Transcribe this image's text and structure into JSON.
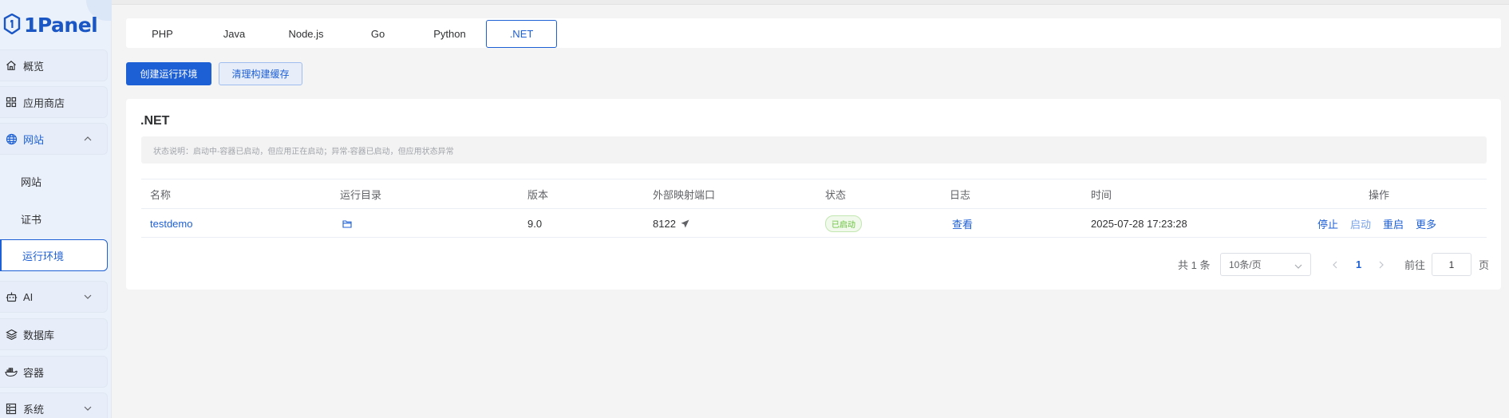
{
  "brand": {
    "logo_text": "1Panel",
    "accent": "#1d5fd4"
  },
  "sidebar": {
    "items": [
      {
        "label": "概览",
        "icon": "home-icon"
      },
      {
        "label": "应用商店",
        "icon": "grid-icon"
      },
      {
        "label": "网站",
        "icon": "globe-icon",
        "expanded": true
      },
      {
        "label": "AI",
        "icon": "robot-icon"
      },
      {
        "label": "数据库",
        "icon": "layers-icon"
      },
      {
        "label": "容器",
        "icon": "docker-icon"
      },
      {
        "label": "系统",
        "icon": "server-icon"
      }
    ],
    "subitems": [
      {
        "label": "网站"
      },
      {
        "label": "证书"
      },
      {
        "label": "运行环境",
        "active": true
      }
    ]
  },
  "tabs": [
    {
      "label": "PHP"
    },
    {
      "label": "Java"
    },
    {
      "label": "Node.js"
    },
    {
      "label": "Go"
    },
    {
      "label": "Python"
    },
    {
      "label": ".NET",
      "active": true
    }
  ],
  "toolbar": {
    "create_label": "创建运行环境",
    "clear_cache_label": "清理构建缓存"
  },
  "card": {
    "title": ".NET",
    "notice": "状态说明：启动中-容器已启动，但应用正在启动；异常-容器已启动，但应用状态异常"
  },
  "table": {
    "headers": {
      "name": "名称",
      "dir": "运行目录",
      "version": "版本",
      "port": "外部映射端口",
      "status": "状态",
      "log": "日志",
      "time": "时间",
      "ops": "操作"
    },
    "rows": [
      {
        "name": "testdemo",
        "version": "9.0",
        "port": "8122",
        "status": "已启动",
        "log": "查看",
        "time": "2025-07-28 17:23:28",
        "ops": {
          "stop": "停止",
          "start": "启动",
          "restart": "重启",
          "more": "更多"
        }
      }
    ]
  },
  "pagination": {
    "total": "共 1 条",
    "page_size": "10条/页",
    "current_page": "1",
    "goto_label": "前往",
    "goto_value": "1",
    "page_suffix": "页"
  }
}
